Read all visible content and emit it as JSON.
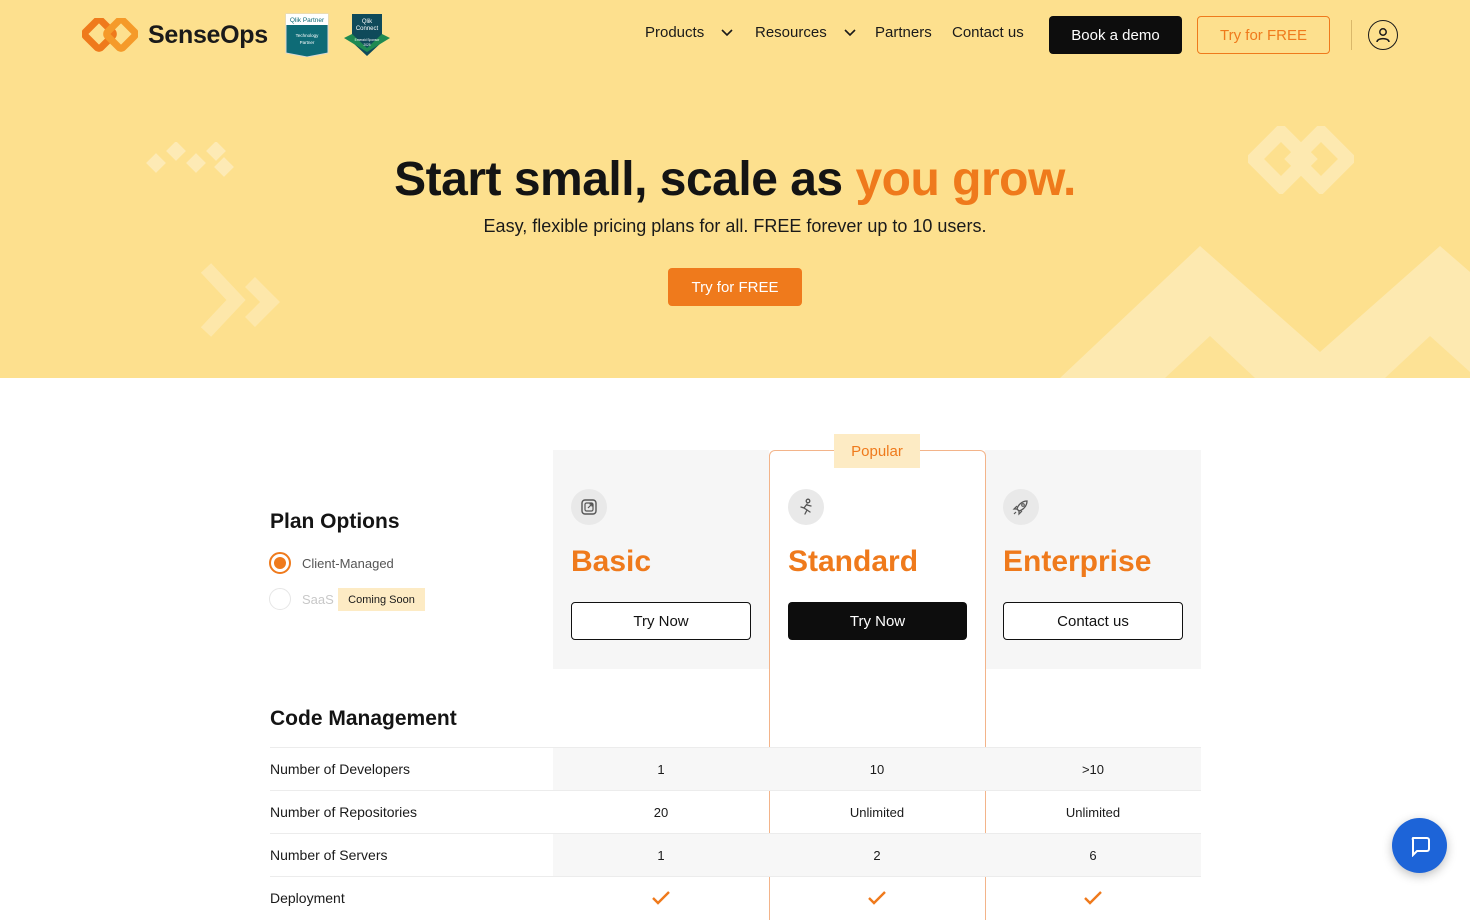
{
  "nav": {
    "brand": "SenseOps",
    "links": [
      {
        "label": "Products",
        "has_dropdown": true
      },
      {
        "label": "Resources",
        "has_dropdown": true
      },
      {
        "label": "Partners",
        "has_dropdown": false
      },
      {
        "label": "Contact us",
        "has_dropdown": false
      }
    ],
    "book_demo": "Book a demo",
    "try_free": "Try for FREE",
    "badges": {
      "qlik_partner": [
        "Qlik Partner",
        "Technology",
        "Partner"
      ],
      "qlik_connect": [
        "Qlik",
        "Connect",
        "Emerald Sponsor",
        "2025"
      ]
    }
  },
  "hero": {
    "title_main": "Start small, scale as ",
    "title_accent": "you grow.",
    "subtitle": "Easy, flexible pricing plans for all. FREE forever up to 10 users.",
    "cta": "Try for FREE"
  },
  "plan_options": {
    "title": "Plan Options",
    "options": [
      {
        "label": "Client-Managed",
        "selected": true,
        "tag": ""
      },
      {
        "label": "SaaS",
        "selected": false,
        "tag": "Coming Soon"
      }
    ]
  },
  "plans": [
    {
      "name": "Basic",
      "button": "Try Now",
      "icon": "external-box-icon",
      "popular": false
    },
    {
      "name": "Standard",
      "button": "Try Now",
      "icon": "runner-icon",
      "popular": true
    },
    {
      "name": "Enterprise",
      "button": "Contact us",
      "icon": "rocket-icon",
      "popular": false
    }
  ],
  "popular_label": "Popular",
  "sections": [
    {
      "title": "Code Management",
      "rows": [
        {
          "label": "Number of Developers",
          "values": [
            "1",
            "10",
            ">10"
          ]
        },
        {
          "label": "Number of Repositories",
          "values": [
            "20",
            "Unlimited",
            "Unlimited"
          ]
        },
        {
          "label": "Number of Servers",
          "values": [
            "1",
            "2",
            "6"
          ]
        },
        {
          "label": "Deployment",
          "values": [
            "check",
            "check",
            "check"
          ]
        }
      ]
    }
  ],
  "colors": {
    "accent": "#ef7a1c",
    "hero_bg": "#fde08e",
    "popular_bg": "#fdebc4",
    "chat_blue": "#1d64d8"
  }
}
